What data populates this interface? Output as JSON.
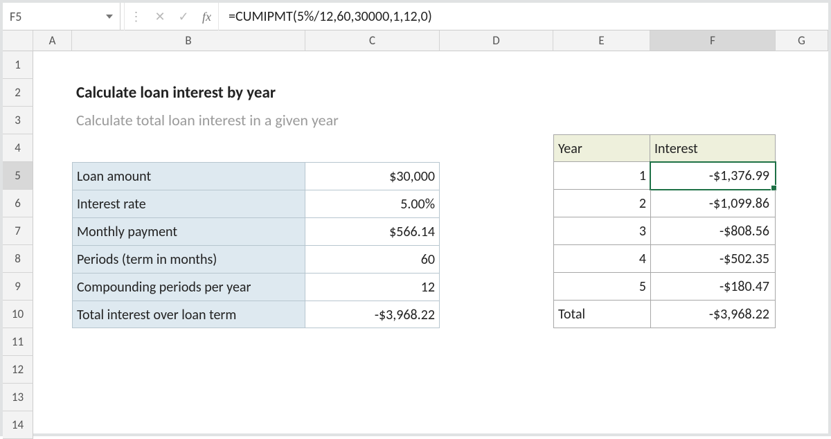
{
  "formula_bar": {
    "cell_ref": "F5",
    "formula": "=CUMIPMT(5%/12,60,30000,1,12,0)"
  },
  "columns": [
    "A",
    "B",
    "C",
    "D",
    "E",
    "F",
    "G"
  ],
  "rows": [
    "1",
    "2",
    "3",
    "4",
    "5",
    "6",
    "7",
    "8",
    "9",
    "10",
    "11",
    "12",
    "13",
    "14"
  ],
  "title": "Calculate loan interest by year",
  "subtitle": "Calculate total loan interest in a given year",
  "loan_box": {
    "rows": [
      {
        "label": "Loan amount",
        "value": "$30,000"
      },
      {
        "label": "Interest rate",
        "value": "5.00%"
      },
      {
        "label": "Monthly payment",
        "value": "$566.14"
      },
      {
        "label": "Periods (term in months)",
        "value": "60"
      },
      {
        "label": "Compounding periods per year",
        "value": "12"
      },
      {
        "label": "Total interest over loan term",
        "value": "-$3,968.22"
      }
    ]
  },
  "year_table": {
    "headers": {
      "e": "Year",
      "f": "Interest"
    },
    "rows": [
      {
        "e": "1",
        "f": "-$1,376.99"
      },
      {
        "e": "2",
        "f": "-$1,099.86"
      },
      {
        "e": "3",
        "f": "-$808.56"
      },
      {
        "e": "4",
        "f": "-$502.35"
      },
      {
        "e": "5",
        "f": "-$180.47"
      }
    ],
    "total": {
      "e": "Total",
      "f": "-$3,968.22"
    }
  },
  "selected": {
    "col": "F",
    "row": "5"
  }
}
